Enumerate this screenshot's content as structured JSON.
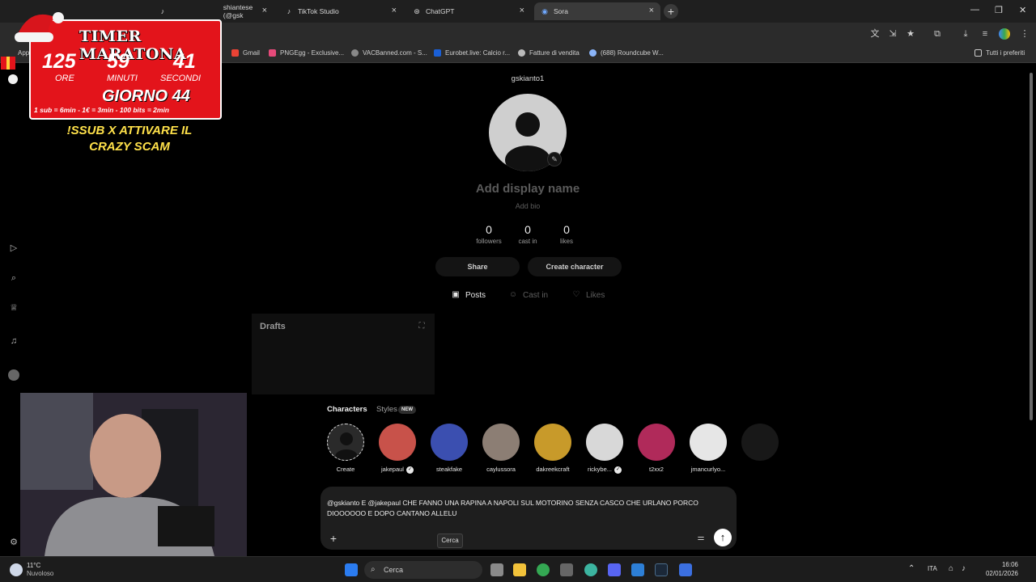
{
  "browser": {
    "tabs": [
      {
        "label": "shiantese (@gsk",
        "icon": "tiktok-icon"
      },
      {
        "label": "TikTok Studio",
        "icon": "tiktok-icon"
      },
      {
        "label": "ChatGPT",
        "icon": "chatgpt-icon"
      },
      {
        "label": "Sora",
        "icon": "sora-icon"
      }
    ],
    "new_tab_icon": "plus-icon",
    "bookmarks": [
      {
        "label": "Gmail",
        "color": "#ea4335"
      },
      {
        "label": "PNGEgg - Exclusive...",
        "color": "#e64a7a"
      },
      {
        "label": "VACBanned.com - S...",
        "color": "#888888"
      },
      {
        "label": "Eurobet.live: Calcio r...",
        "color": "#1a5fd6"
      },
      {
        "label": "Fatture di vendita",
        "color": "#bbbbbb"
      },
      {
        "label": "(688) Roundcube W...",
        "color": "#8ab4f8"
      }
    ],
    "bookmarks_folder": "Tutti i preferiti",
    "apps_partial": "App"
  },
  "overlay": {
    "timer_title": "TIMER MARATONA",
    "hours": "125",
    "minutes": "59",
    "seconds": "41",
    "hours_label": "ORE",
    "minutes_label": "MINUTI",
    "seconds_label": "SECONDI",
    "day": "GIORNO 44",
    "rate": "1 sub = 6min - 1€ = 3min - 100 bits = 2min",
    "promo": "!SSUB X ATTIVARE IL CRAZY SCAM"
  },
  "profile": {
    "username": "gskianto1",
    "display_name_placeholder": "Add display name",
    "bio_placeholder": "Add bio",
    "stats": [
      {
        "value": "0",
        "label": "followers"
      },
      {
        "value": "0",
        "label": "cast in"
      },
      {
        "value": "0",
        "label": "likes"
      }
    ],
    "share_label": "Share",
    "create_character_label": "Create character",
    "tabs": [
      {
        "label": "Posts",
        "icon": "posts-icon"
      },
      {
        "label": "Cast in",
        "icon": "cast-in-icon"
      },
      {
        "label": "Likes",
        "icon": "heart-icon"
      }
    ]
  },
  "drafts": {
    "title": "Drafts"
  },
  "composer": {
    "tab_characters": "Characters",
    "tab_styles": "Styles",
    "badge_new": "NEW",
    "characters": [
      {
        "name": "Create",
        "verified": false
      },
      {
        "name": "jakepaul",
        "verified": true
      },
      {
        "name": "steakfake",
        "verified": false
      },
      {
        "name": "caylussora",
        "verified": false
      },
      {
        "name": "dakreekcraft",
        "verified": false
      },
      {
        "name": "rickybe...",
        "verified": true
      },
      {
        "name": "t2xx2",
        "verified": false
      },
      {
        "name": "jmancurlyo...",
        "verified": false
      }
    ],
    "prompt": "@gskianto E @jakepaul CHE FANNO UNA RAPINA A NAPOLI SUL MOTORINO SENZA CASCO CHE URLANO PORCO DIOOOOOO E DOPO CANTANO ALLELU",
    "tooltip": "Cerca"
  },
  "taskbar": {
    "weather_temp": "11°C",
    "weather_desc": "Nuvoloso",
    "search_placeholder": "Cerca",
    "language": "ITA",
    "time": "16:06",
    "date": "02/01/2026"
  },
  "colors": {
    "timer_red": "#e3141b",
    "promo_yellow": "#ffe14a",
    "background": "#000000"
  }
}
